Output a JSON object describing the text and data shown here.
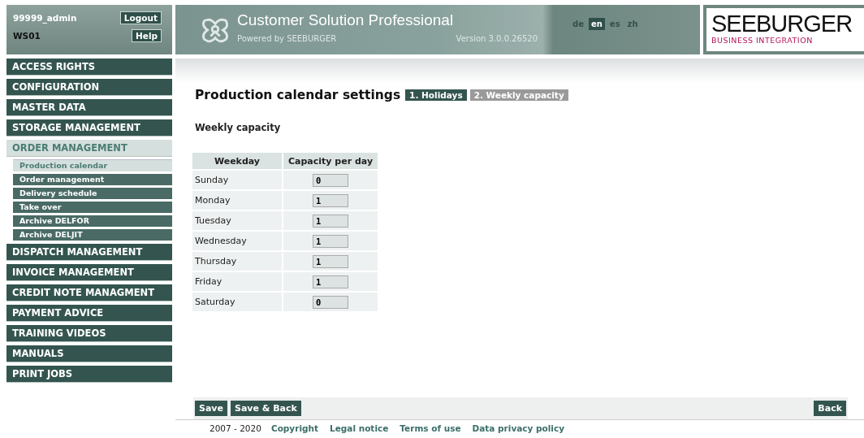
{
  "user": {
    "name": "99999_admin",
    "workstation": "WS01",
    "logout": "Logout",
    "help": "Help"
  },
  "header": {
    "title": "Customer Solution Professional",
    "subtitle": "Powered by SEEBURGER",
    "version": "Version 3.0.0.26520",
    "languages": [
      {
        "label": "de",
        "selected": false
      },
      {
        "label": "en",
        "selected": true
      },
      {
        "label": "es",
        "selected": false
      },
      {
        "label": "zh",
        "selected": false
      }
    ],
    "logo": {
      "name": "SEEBURGER",
      "tagline": "BUSINESS INTEGRATION"
    }
  },
  "sidebar": {
    "items": [
      {
        "label": "ACCESS RIGHTS",
        "selected": false
      },
      {
        "label": "CONFIGURATION",
        "selected": false
      },
      {
        "label": "MASTER DATA",
        "selected": false
      },
      {
        "label": "STORAGE MANAGEMENT",
        "selected": false
      },
      {
        "label": "ORDER MANAGEMENT",
        "selected": true,
        "children": [
          {
            "label": "Production calendar",
            "selected": true
          },
          {
            "label": "Order management",
            "selected": false
          },
          {
            "label": "Delivery schedule",
            "selected": false
          },
          {
            "label": "Take over",
            "selected": false
          },
          {
            "label": "Archive DELFOR",
            "selected": false
          },
          {
            "label": "Archive DELJIT",
            "selected": false
          }
        ]
      },
      {
        "label": "DISPATCH MANAGEMENT",
        "selected": false
      },
      {
        "label": "INVOICE MANAGEMENT",
        "selected": false
      },
      {
        "label": "CREDIT NOTE MANAGMENT",
        "selected": false
      },
      {
        "label": "PAYMENT ADVICE",
        "selected": false
      },
      {
        "label": "TRAINING VIDEOS",
        "selected": false
      },
      {
        "label": "MANUALS",
        "selected": false
      },
      {
        "label": "PRINT JOBS",
        "selected": false
      }
    ]
  },
  "page": {
    "title": "Production calendar settings",
    "steps": [
      {
        "label": "1. Holidays",
        "selected": false
      },
      {
        "label": "2. Weekly capacity",
        "selected": true
      }
    ],
    "section": "Weekly capacity",
    "table": {
      "columns": [
        "Weekday",
        "Capacity per day"
      ],
      "rows": [
        {
          "weekday": "Sunday",
          "capacity": "0"
        },
        {
          "weekday": "Monday",
          "capacity": "1"
        },
        {
          "weekday": "Tuesday",
          "capacity": "1"
        },
        {
          "weekday": "Wednesday",
          "capacity": "1"
        },
        {
          "weekday": "Thursday",
          "capacity": "1"
        },
        {
          "weekday": "Friday",
          "capacity": "1"
        },
        {
          "weekday": "Saturday",
          "capacity": "0"
        }
      ]
    }
  },
  "actions": {
    "left": [
      "Save",
      "Save & Back"
    ],
    "right": [
      "Back"
    ]
  },
  "footer": {
    "years": "2007 - 2020",
    "links": [
      "Copyright",
      "Legal notice",
      "Terms of use",
      "Data privacy policy"
    ]
  }
}
